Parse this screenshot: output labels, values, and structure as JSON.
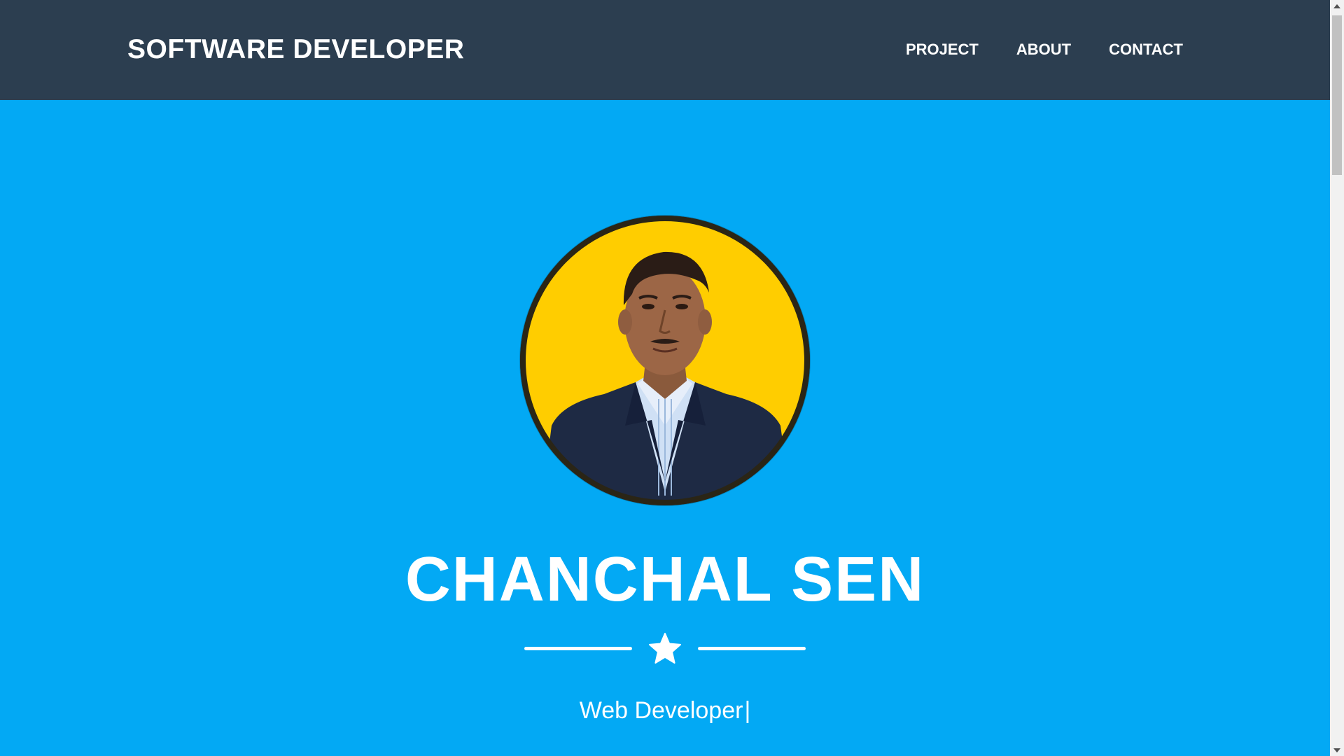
{
  "navbar": {
    "brand": "SOFTWARE DEVELOPER",
    "links": [
      {
        "label": "PROJECT"
      },
      {
        "label": "ABOUT"
      },
      {
        "label": "CONTACT"
      }
    ]
  },
  "masthead": {
    "name": "CHANCHAL SEN",
    "subtitle": "Web Developer",
    "cursor": "|",
    "divider_icon": "star-icon",
    "avatar_icon": "profile-photo"
  },
  "colors": {
    "navbar_bg": "#2c3e50",
    "masthead_bg": "#03a9f4",
    "avatar_bg": "#ffcd00",
    "text": "#ffffff"
  }
}
